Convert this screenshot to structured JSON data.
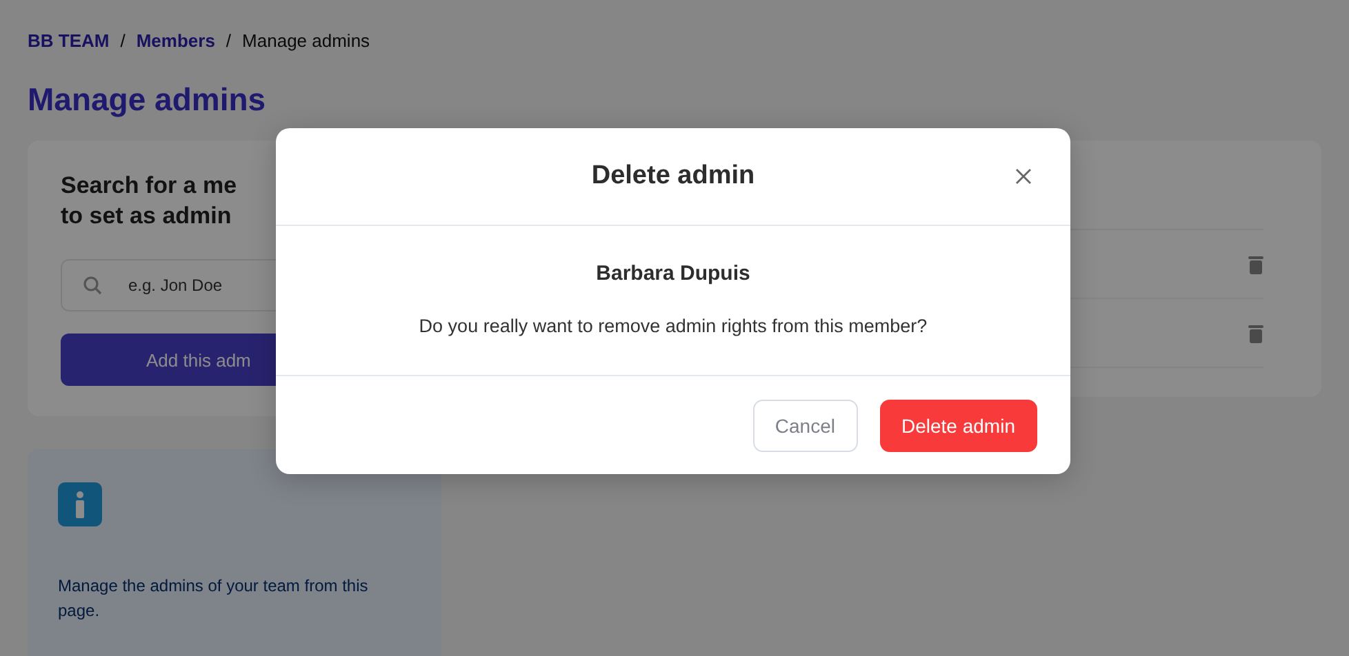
{
  "breadcrumb": [
    {
      "label": "BB TEAM",
      "kind": "link"
    },
    {
      "label": "/",
      "kind": "separator"
    },
    {
      "label": "Members",
      "kind": "link"
    },
    {
      "label": "/",
      "kind": "separator"
    },
    {
      "label": "Manage admins",
      "kind": "current"
    }
  ],
  "page_title": "Manage admins",
  "search_card": {
    "title_lines": [
      "Search for a me",
      "to set as admin"
    ],
    "placeholder": "e.g. Jon Doe",
    "button": "Add this adm"
  },
  "admin_list": {
    "rows": [
      {
        "kind": "admin"
      },
      {
        "kind": "admin"
      }
    ]
  },
  "info_card": {
    "text": "Manage the admins of your team from this page."
  },
  "dialog": {
    "title": "Delete admin",
    "member_name": "Barbara Dupuis",
    "message": "Do you really want to remove admin rights from this member?",
    "buttons": [
      {
        "label": "Cancel",
        "kind": "secondary"
      },
      {
        "label": "Delete admin",
        "kind": "danger"
      }
    ]
  }
}
